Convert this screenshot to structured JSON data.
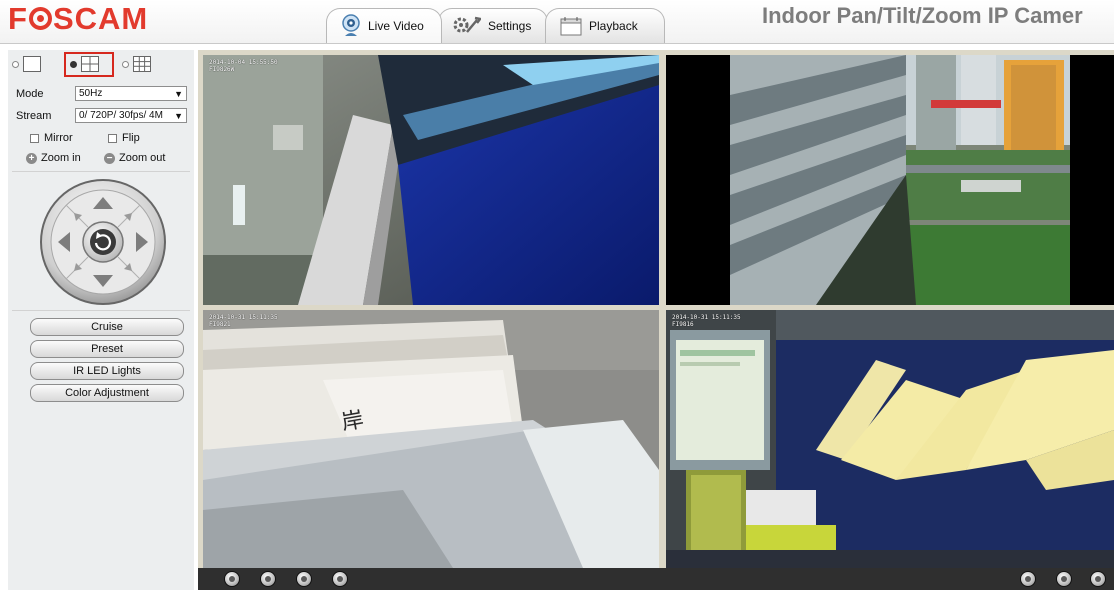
{
  "header": {
    "logo_text_pre": "F",
    "logo_text_post": "SCAM",
    "product_title": "Indoor Pan/Tilt/Zoom IP Camer",
    "brand_color": "#e23a2d",
    "tabs": [
      {
        "label": "Live Video",
        "icon": "webcam-icon",
        "active": true
      },
      {
        "label": "Settings",
        "icon": "wrench-gear-icon",
        "active": false
      },
      {
        "label": "Playback",
        "icon": "calendar-icon",
        "active": false
      }
    ]
  },
  "controls": {
    "layout_options": [
      "single-view",
      "quad-view",
      "nine-view"
    ],
    "selected_layout": "quad-view",
    "mode_label": "Mode",
    "mode_value": "50Hz",
    "stream_label": "Stream",
    "stream_value": "0/ 720P/ 30fps/ 4M",
    "mirror_label": "Mirror",
    "flip_label": "Flip",
    "zoom_in_label": "Zoom in",
    "zoom_out_label": "Zoom out",
    "buttons": {
      "cruise": "Cruise",
      "preset": "Preset",
      "ir_led": "IR LED Lights",
      "color": "Color Adjustment"
    }
  },
  "feeds": [
    {
      "osd_date": "2014-10-04 15:55:50",
      "osd_name": "FI9826W"
    },
    {
      "osd_date": "",
      "osd_name": ""
    },
    {
      "osd_date": "2014-10-31 15:11:35",
      "osd_name": "FI9821"
    },
    {
      "osd_date": "2014-10-31 15:11:35",
      "osd_name": "FI9816"
    }
  ],
  "bottom_bar": {
    "left_buttons": [
      "play-icon",
      "stop-icon",
      "talk-icon",
      "audio-icon"
    ],
    "right_buttons": [
      "snapshot-icon",
      "record-icon",
      "fullscreen-icon"
    ]
  }
}
